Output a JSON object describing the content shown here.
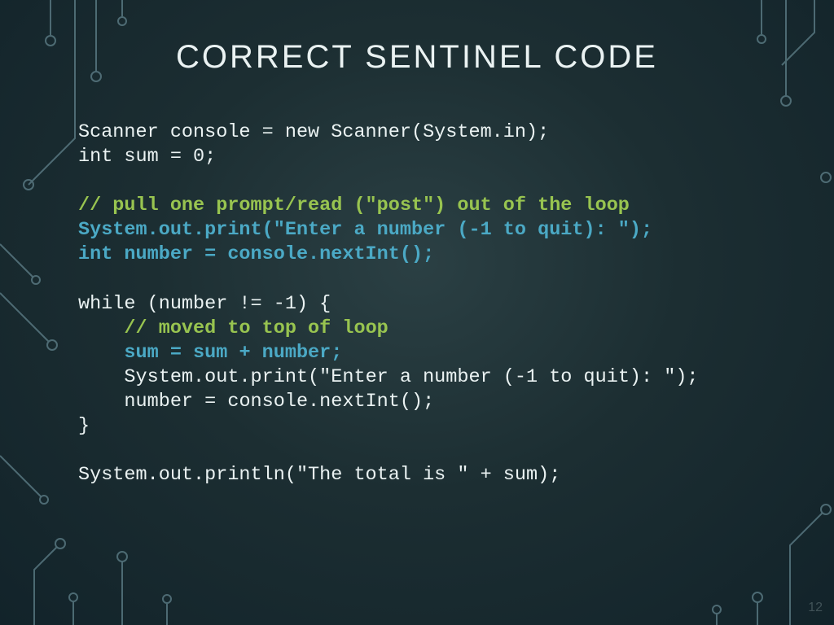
{
  "slide": {
    "title": "CORRECT SENTINEL CODE",
    "page_number": "12"
  },
  "code": {
    "l1": "Scanner console = new Scanner(System.in);",
    "l2": "int sum = 0;",
    "l3_comment": "// pull one prompt/read (\"post\") out of the loop",
    "l4_prompt": "System.out.print(\"Enter a number (-1 to quit): \");",
    "l5_declare": "int number = console.nextInt();",
    "l6_while": "while (number != -1) {",
    "l7_comment": "    // moved to top of loop",
    "l8_sum": "    sum = sum + number;",
    "l9_print": "    System.out.print(\"Enter a number (-1 to quit): \");",
    "l10_next": "    number = console.nextInt();",
    "l11_close": "}",
    "l12_out": "System.out.println(\"The total is \" + sum);"
  }
}
